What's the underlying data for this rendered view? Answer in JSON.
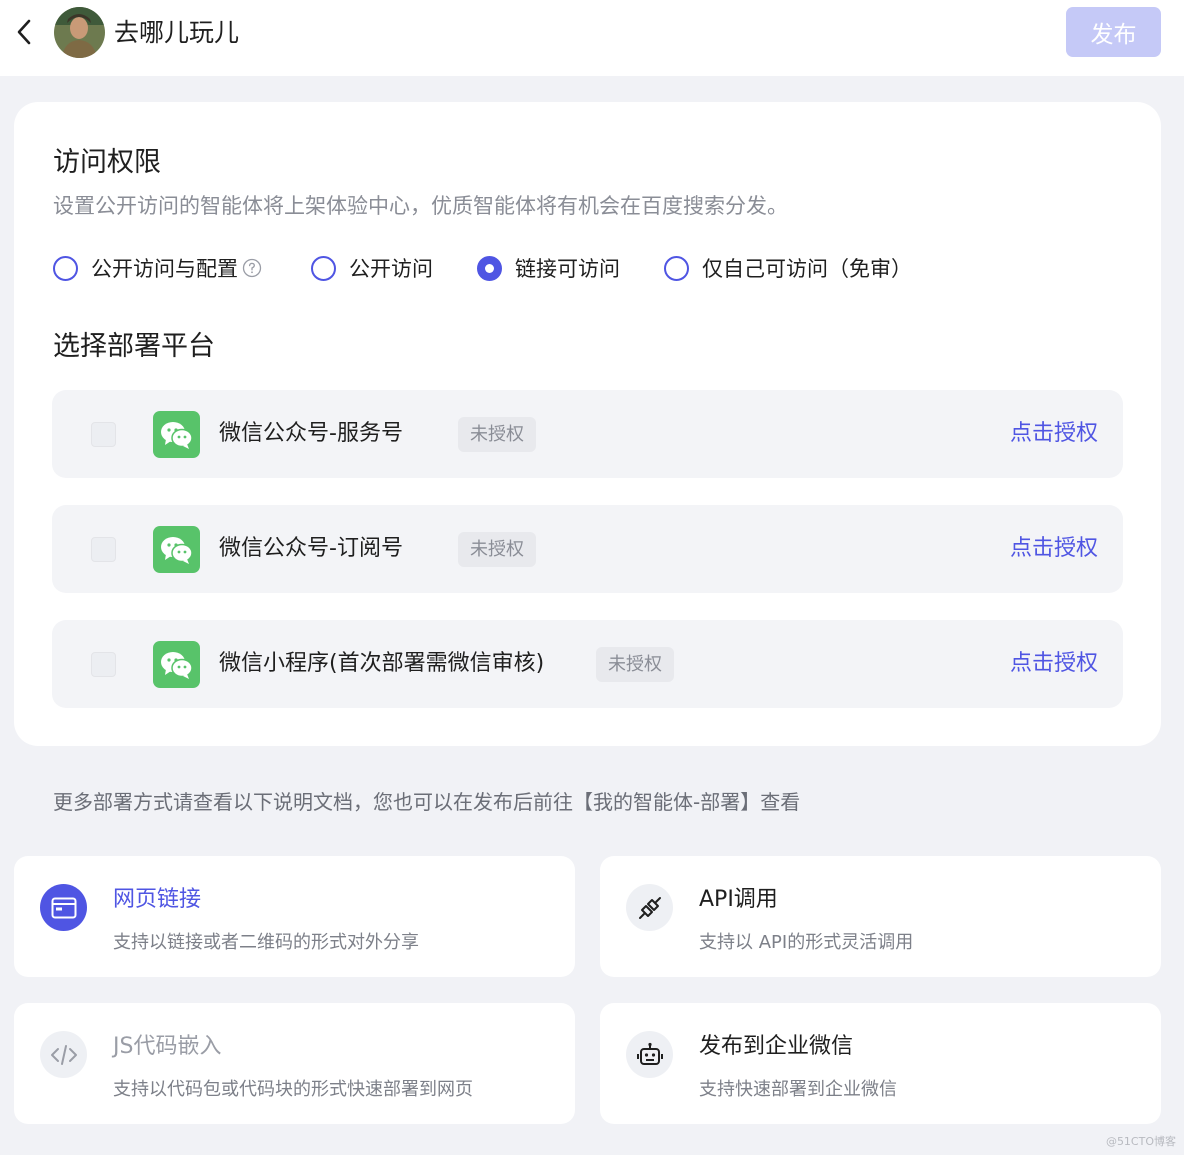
{
  "header": {
    "title": "去哪儿玩儿",
    "publish_label": "发布"
  },
  "access": {
    "title": "访问权限",
    "desc": "设置公开访问的智能体将上架体验中心，优质智能体将有机会在百度搜索分发。",
    "options": [
      {
        "label": "公开访问与配置",
        "checked": false
      },
      {
        "label": "公开访问",
        "checked": false
      },
      {
        "label": "链接可访问",
        "checked": true
      },
      {
        "label": "仅自己可访问（免审）",
        "checked": false
      }
    ]
  },
  "platforms": {
    "title": "选择部署平台",
    "items": [
      {
        "name": "微信公众号-服务号",
        "status": "未授权",
        "action": "点击授权",
        "icon": "wechat-icon"
      },
      {
        "name": "微信公众号-订阅号",
        "status": "未授权",
        "action": "点击授权",
        "icon": "wechat-icon"
      },
      {
        "name": "微信小程序(首次部署需微信审核)",
        "status": "未授权",
        "action": "点击授权",
        "icon": "wechat-icon"
      }
    ]
  },
  "more_note": "更多部署方式请查看以下说明文档，您也可以在发布后前往【我的智能体-部署】查看",
  "methods": [
    {
      "title": "网页链接",
      "desc": "支持以链接或者二维码的形式对外分享",
      "icon": "browser-window-icon"
    },
    {
      "title": "API调用",
      "desc": "支持以 API的形式灵活调用",
      "icon": "plug-icon"
    },
    {
      "title": "JS代码嵌入",
      "desc": "支持以代码包或代码块的形式快速部署到网页",
      "icon": "code-icon"
    },
    {
      "title": "发布到企业微信",
      "desc": "支持快速部署到企业微信",
      "icon": "robot-icon"
    }
  ],
  "colors": {
    "accent": "#4f55e3",
    "publish_disabled": "#c5c9f7",
    "wechat_green": "#58c36a"
  },
  "watermark": "@51CTO博客"
}
